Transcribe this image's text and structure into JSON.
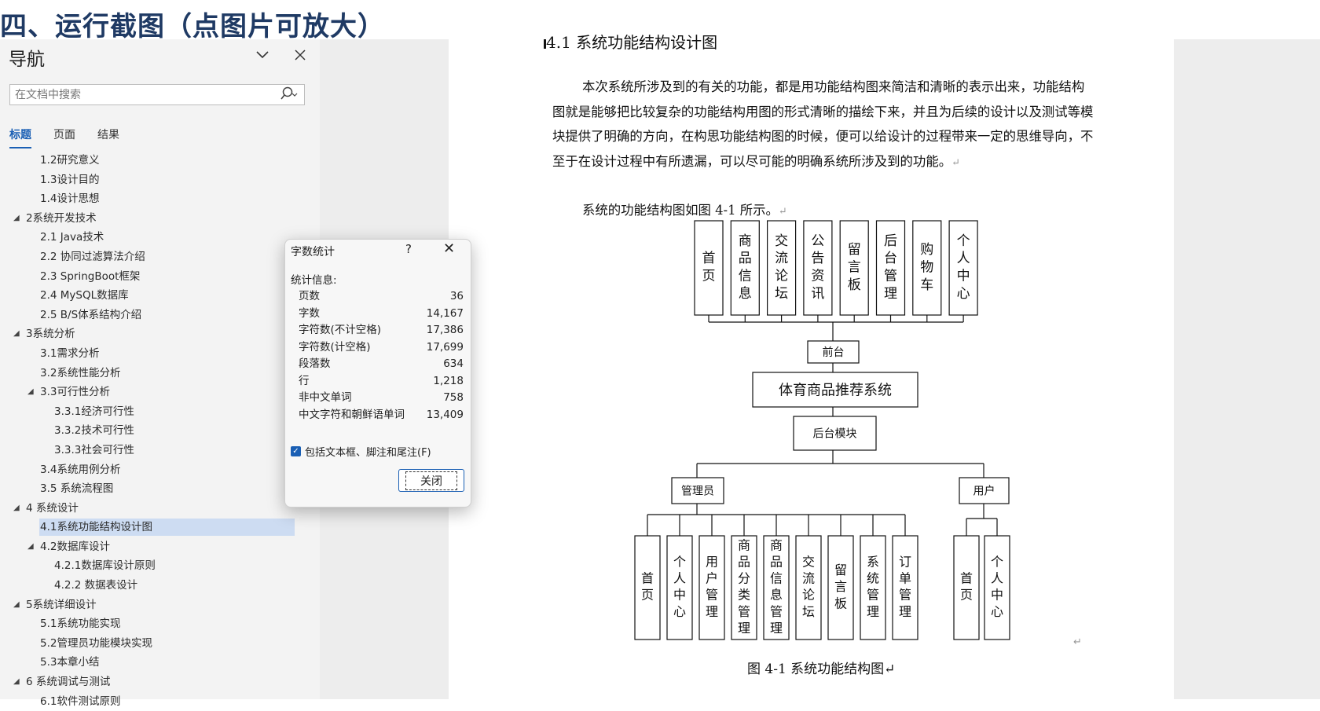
{
  "page_heading": "四、运行截图（点图片可放大）",
  "nav": {
    "title": "导航",
    "search_placeholder": "在文档中搜索",
    "tabs": [
      "标题",
      "页面",
      "结果"
    ],
    "outline": [
      {
        "label": "1.2研究意义",
        "level": 2,
        "expand": ""
      },
      {
        "label": "1.3设计目的",
        "level": 2,
        "expand": ""
      },
      {
        "label": "1.4设计思想",
        "level": 2,
        "expand": ""
      },
      {
        "label": "2系统开发技术",
        "level": 1,
        "expand": "◢"
      },
      {
        "label": "2.1 Java技术",
        "level": 2,
        "expand": ""
      },
      {
        "label": "2.2 协同过滤算法介绍",
        "level": 2,
        "expand": ""
      },
      {
        "label": "2.3 SpringBoot框架",
        "level": 2,
        "expand": ""
      },
      {
        "label": "2.4 MySQL数据库",
        "level": 2,
        "expand": ""
      },
      {
        "label": "2.5 B/S体系结构介绍",
        "level": 2,
        "expand": ""
      },
      {
        "label": "3系统分析",
        "level": 1,
        "expand": "◢"
      },
      {
        "label": "3.1需求分析",
        "level": 2,
        "expand": ""
      },
      {
        "label": "3.2系统性能分析",
        "level": 2,
        "expand": ""
      },
      {
        "label": "3.3可行性分析",
        "level": 2,
        "expand": "◢"
      },
      {
        "label": "3.3.1经济可行性",
        "level": 3,
        "expand": ""
      },
      {
        "label": "3.3.2技术可行性",
        "level": 3,
        "expand": ""
      },
      {
        "label": "3.3.3社会可行性",
        "level": 3,
        "expand": ""
      },
      {
        "label": "3.4系统用例分析",
        "level": 2,
        "expand": ""
      },
      {
        "label": "3.5 系统流程图",
        "level": 2,
        "expand": ""
      },
      {
        "label": "4 系统设计",
        "level": 1,
        "expand": "◢"
      },
      {
        "label": "4.1系统功能结构设计图",
        "level": 2,
        "expand": "",
        "selected": true
      },
      {
        "label": "4.2数据库设计",
        "level": 2,
        "expand": "◢"
      },
      {
        "label": "4.2.1数据库设计原则",
        "level": 3,
        "expand": ""
      },
      {
        "label": "4.2.2 数据表设计",
        "level": 3,
        "expand": ""
      },
      {
        "label": "5系统详细设计",
        "level": 1,
        "expand": "◢"
      },
      {
        "label": "5.1系统功能实现",
        "level": 2,
        "expand": ""
      },
      {
        "label": "5.2管理员功能模块实现",
        "level": 2,
        "expand": ""
      },
      {
        "label": "5.3本章小结",
        "level": 2,
        "expand": ""
      },
      {
        "label": "6 系统调试与测试",
        "level": 1,
        "expand": "◢"
      },
      {
        "label": "6.1软件测试原则",
        "level": 2,
        "expand": ""
      }
    ]
  },
  "doc": {
    "section_heading": "4.1 系统功能结构设计图",
    "paragraph": "本次系统所涉及到的有关的功能，都是用功能结构图来简洁和清晰的表示出来，功能结构图就是能够把比较复杂的功能结构用图的形式清晰的描绘下来，并且为后续的设计以及测试等模块提供了明确的方向，在构思功能结构图的时候，便可以给设计的过程带来一定的思维导向，不至于在设计过程中有所遗漏，可以尽可能的明确系统所涉及到的功能。",
    "paragraph2": "系统的功能结构图如图 4-1 所示。",
    "para_mark": "↵",
    "caption": "图  4-1 系统功能结构图↵",
    "end_mark": "↵",
    "diagram": {
      "front_modules": [
        "首页",
        "商品信息",
        "交流论坛",
        "公告资讯",
        "留言板",
        "后台管理",
        "购物车",
        "个人中心"
      ],
      "front_label": "前台",
      "system_label": "体育商品推荐系统",
      "back_label": "后台模块",
      "admin_label": "管理员",
      "user_label": "用户",
      "admin_modules": [
        "首页",
        "个人中心",
        "用户管理",
        "商品分类管理",
        "商品信息管理",
        "交流论坛",
        "留言板",
        "系统管理",
        "订单管理"
      ],
      "user_modules": [
        "首页",
        "个人中心"
      ]
    }
  },
  "word_count": {
    "title": "字数统计",
    "help": "?",
    "close_x": "✕",
    "stats_label": "统计信息:",
    "rows": [
      {
        "k": "页数",
        "v": "36"
      },
      {
        "k": "字数",
        "v": "14,167"
      },
      {
        "k": "字符数(不计空格)",
        "v": "17,386"
      },
      {
        "k": "字符数(计空格)",
        "v": "17,699"
      },
      {
        "k": "段落数",
        "v": "634"
      },
      {
        "k": "行",
        "v": "1,218"
      },
      {
        "k": "非中文单词",
        "v": "758"
      },
      {
        "k": "中文字符和朝鲜语单词",
        "v": "13,409"
      }
    ],
    "checkbox_label": "包括文本框、脚注和尾注(F)",
    "close_button": "关闭"
  },
  "icons": {
    "chevron": "chevron-down-icon",
    "close": "close-icon",
    "search": "search-icon",
    "check": "checkbox-checked-icon"
  },
  "colors": {
    "accent": "#1a5fb4",
    "heading": "#1f3a64",
    "selection": "#cddcf2",
    "nav_bg": "#f3f3f3"
  }
}
